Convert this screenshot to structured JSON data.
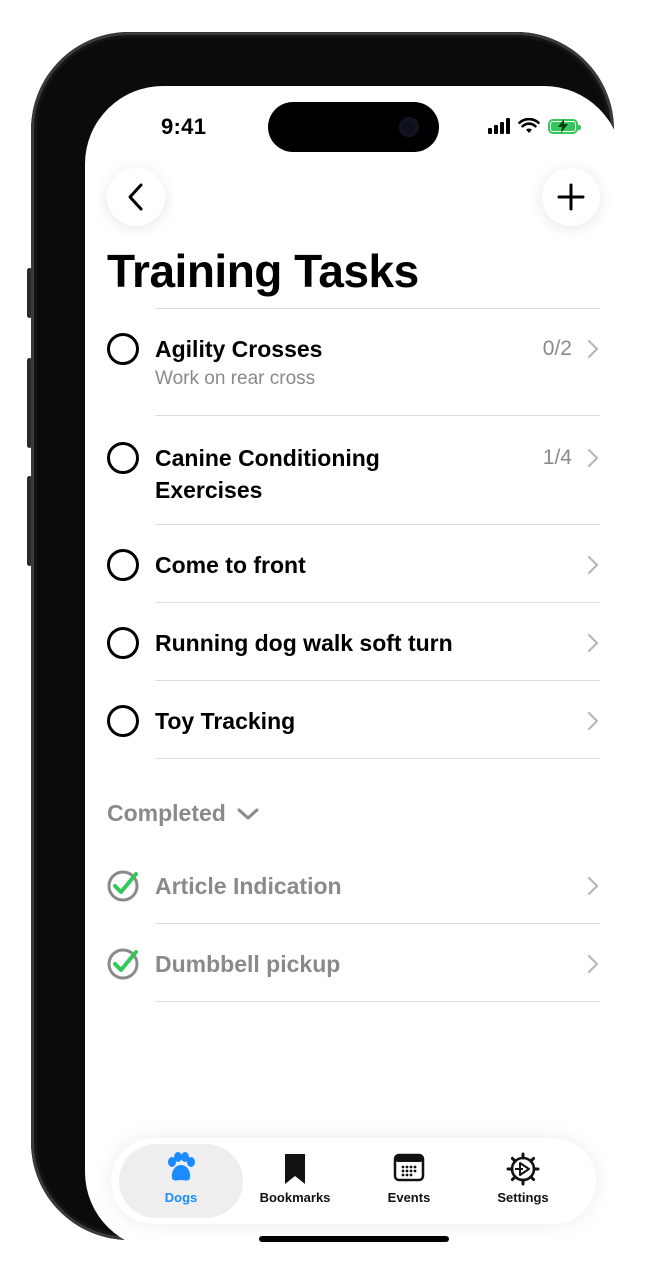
{
  "status_bar": {
    "time": "9:41"
  },
  "nav": {
    "back_icon": "chevron-left-icon",
    "add_icon": "plus-icon"
  },
  "page": {
    "title": "Training Tasks"
  },
  "tasks": [
    {
      "name": "Agility Crosses",
      "subtitle": "Work on rear cross",
      "progress": "0/2"
    },
    {
      "name": "Canine Conditioning Exercises",
      "progress": "1/4"
    },
    {
      "name": "Come to front"
    },
    {
      "name": "Running dog walk soft turn"
    },
    {
      "name": "Toy Tracking"
    }
  ],
  "completed": {
    "label": "Completed",
    "items": [
      {
        "name": "Article Indication"
      },
      {
        "name": "Dumbbell pickup"
      }
    ]
  },
  "tabbar": {
    "tabs": [
      {
        "label": "Dogs",
        "icon": "paw-icon",
        "active": true
      },
      {
        "label": "Bookmarks",
        "icon": "bookmark-icon",
        "active": false
      },
      {
        "label": "Events",
        "icon": "calendar-icon",
        "active": false
      },
      {
        "label": "Settings",
        "icon": "gear-icon",
        "active": false
      }
    ]
  },
  "colors": {
    "accent": "#1a8cff",
    "check_green": "#34c759",
    "secondary_text": "#8a8a8a"
  }
}
